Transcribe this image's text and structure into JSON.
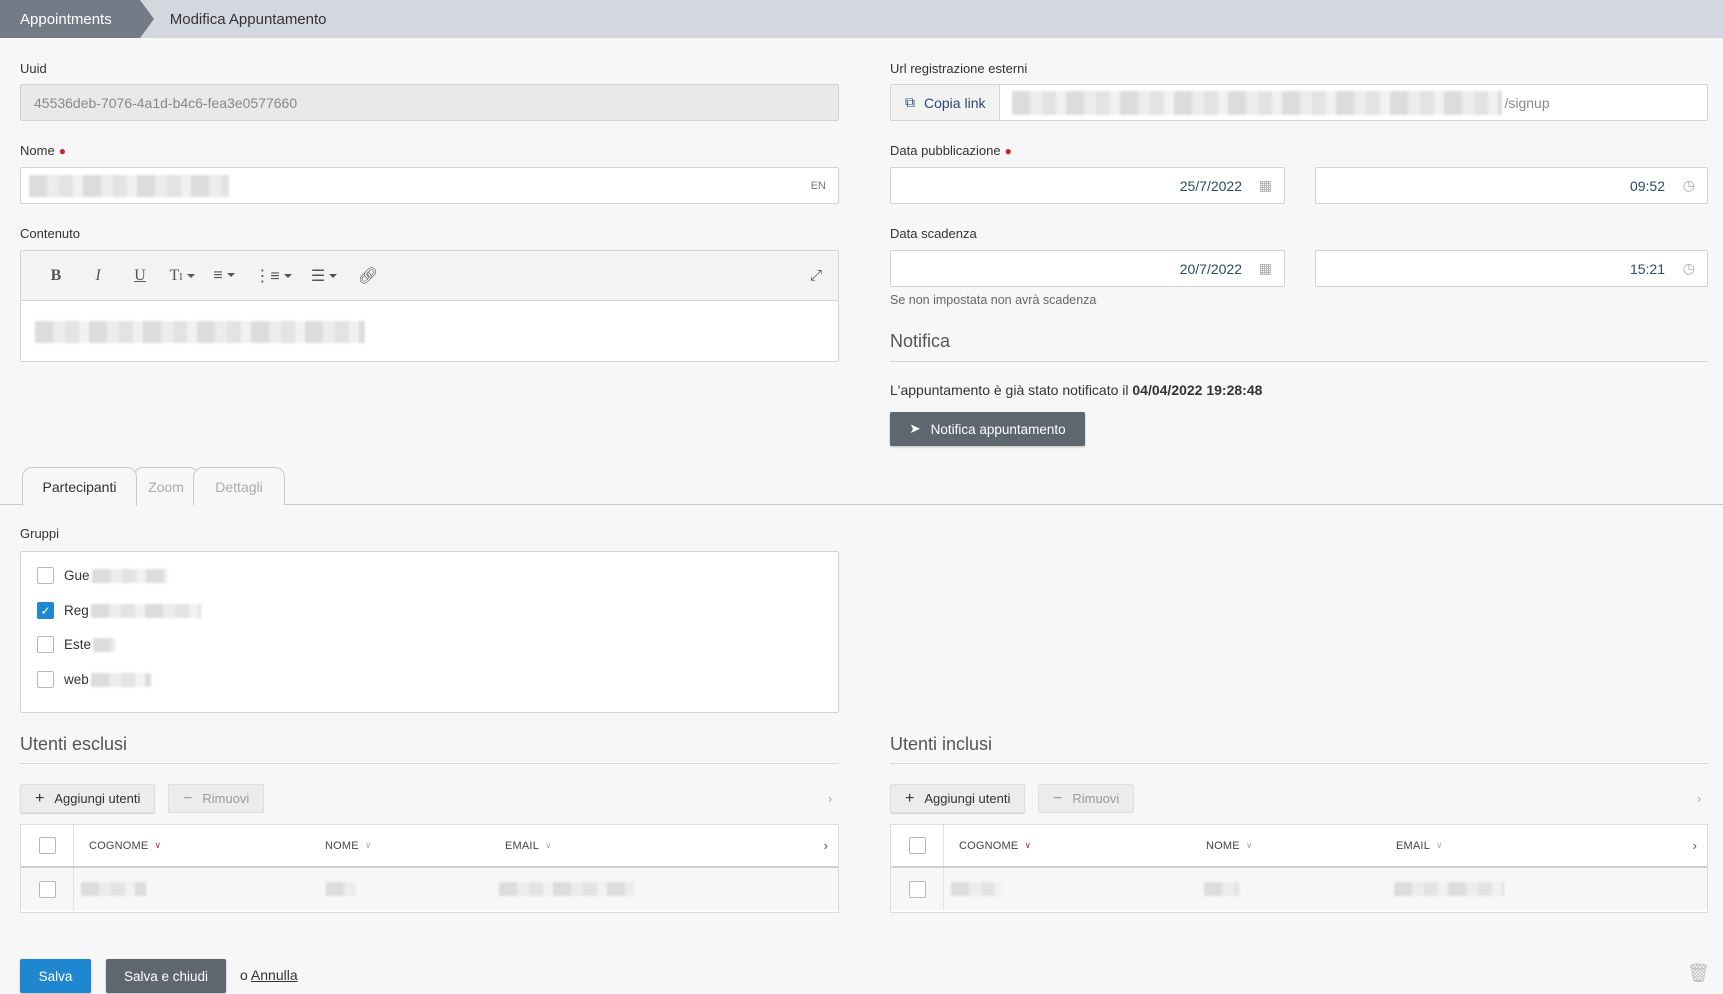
{
  "breadcrumb": {
    "root": "Appointments",
    "current": "Modifica Appuntamento"
  },
  "form": {
    "uuid_label": "Uuid",
    "uuid_value": "45536deb-7076-4a1d-b4c6-fea3e0577660",
    "nome_label": "Nome",
    "nome_lang": "EN",
    "contenuto_label": "Contenuto",
    "url_label": "Url registrazione esterni",
    "copy_link": "Copia link",
    "url_suffix": "/signup",
    "pub_label": "Data pubblicazione",
    "pub_date": "25/7/2022",
    "pub_time": "09:52",
    "exp_label": "Data scadenza",
    "exp_date": "20/7/2022",
    "exp_time": "15:21",
    "exp_help": "Se non impostata non avrà scadenza"
  },
  "notifica": {
    "title": "Notifica",
    "text": "L'appuntamento è già stato notificato il ",
    "datetime": "04/04/2022 19:28:48",
    "button": "Notifica appuntamento"
  },
  "tabs": [
    {
      "label": "Partecipanti",
      "active": true
    },
    {
      "label": "Zoom",
      "active": false
    },
    {
      "label": "Dettagli",
      "active": false
    }
  ],
  "groups": {
    "label": "Gruppi",
    "items": [
      {
        "label": "Gue",
        "checked": false
      },
      {
        "label": "Reg",
        "checked": true
      },
      {
        "label": "Este",
        "checked": false
      },
      {
        "label": "web",
        "checked": false
      }
    ]
  },
  "excluded": {
    "title": "Utenti esclusi",
    "add": "Aggiungi utenti",
    "remove": "Rimuovi",
    "columns": [
      "COGNOME",
      "NOME",
      "EMAIL"
    ]
  },
  "included": {
    "title": "Utenti inclusi",
    "add": "Aggiungi utenti",
    "remove": "Rimuovi",
    "columns": [
      "COGNOME",
      "NOME",
      "EMAIL"
    ]
  },
  "footer": {
    "save": "Salva",
    "save_close": "Salva e chiudi",
    "or": "o",
    "cancel": "Annulla"
  },
  "colors": {
    "accent": "#1f87cf",
    "dark_button": "#5e6670",
    "breadcrumb_active": "#727b86",
    "required": "#c0282d"
  }
}
